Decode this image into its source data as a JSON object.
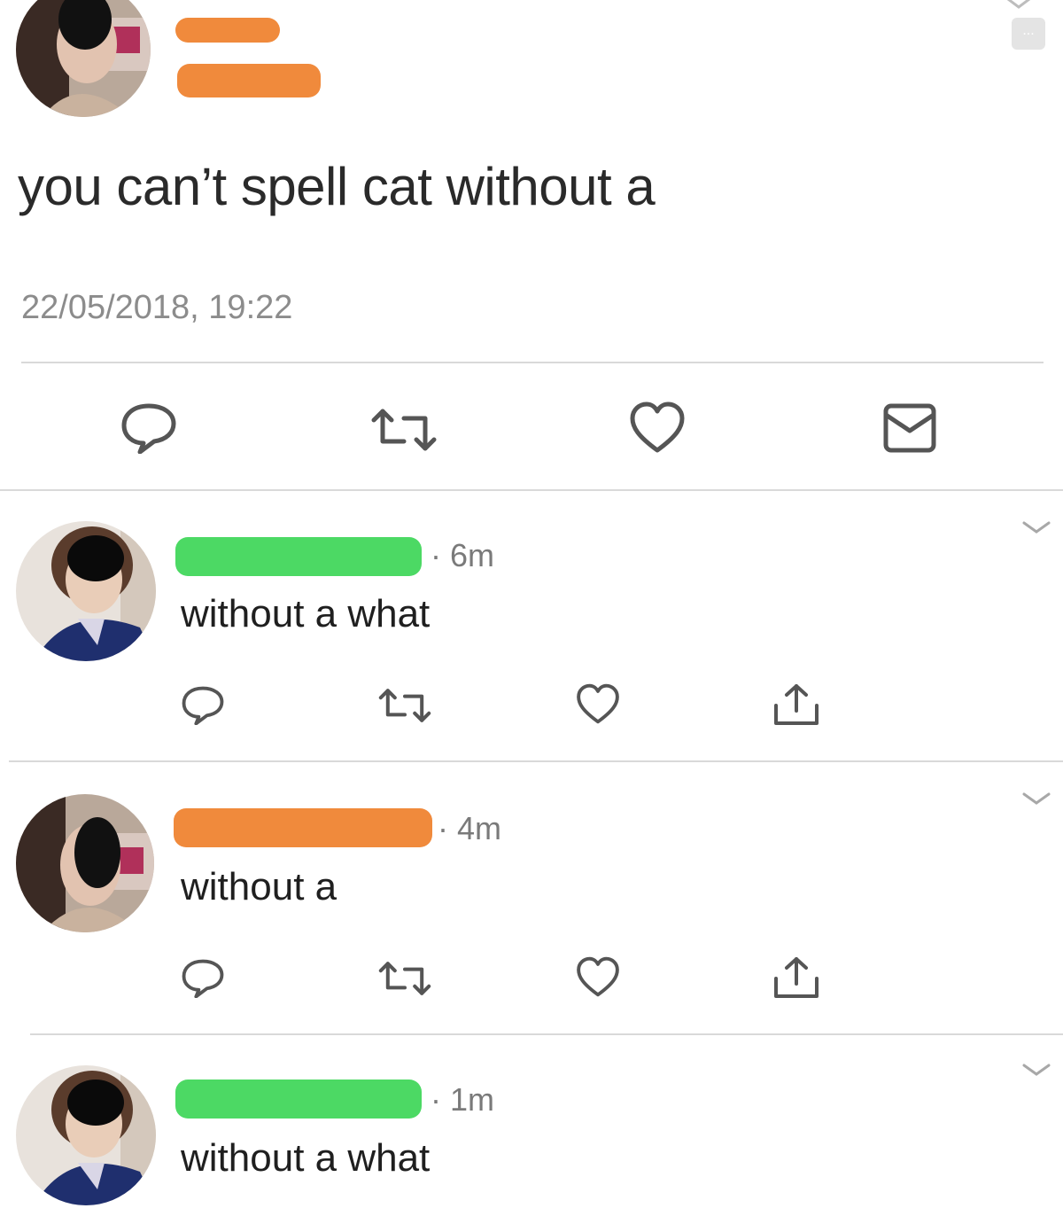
{
  "tweet": {
    "text": "you can’t spell cat without a",
    "timestamp": "22/05/2018, 19:22",
    "actions": [
      "reply-icon",
      "retweet-icon",
      "like-icon",
      "message-icon"
    ]
  },
  "replies": [
    {
      "time": "· 6m",
      "text": "without a what",
      "redaction_color": "#4cd964"
    },
    {
      "time": "· 4m",
      "text": "without a",
      "redaction_color": "#f08a3c"
    },
    {
      "time": "· 1m",
      "text": "without a what",
      "redaction_color": "#4cd964"
    }
  ],
  "more_button": {
    "label": "..."
  },
  "colors": {
    "redaction_orange": "#f08a3c",
    "redaction_green": "#4cd964",
    "icon_gray": "#8a8a8a",
    "divider": "#d9d9d9"
  }
}
